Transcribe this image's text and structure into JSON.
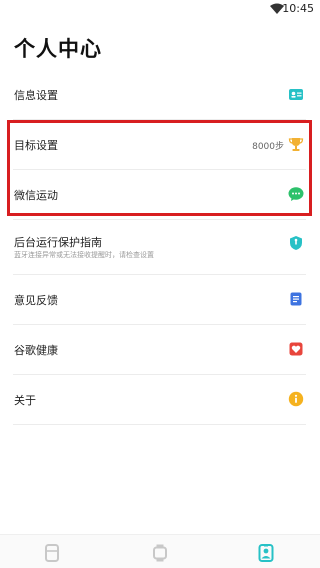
{
  "status_bar": {
    "time": "10:45"
  },
  "header": {
    "title": "个人中心"
  },
  "menu": [
    {
      "label": "信息设置",
      "icon": "id-card-icon"
    },
    {
      "label": "目标设置",
      "value": "8000步",
      "icon": "trophy-icon"
    },
    {
      "label": "微信运动",
      "icon": "wechat-icon"
    },
    {
      "label": "后台运行保护指南",
      "sub": "蓝牙连接异常或无法接收提醒时，请检查设置",
      "icon": "shield-icon"
    },
    {
      "label": "意见反馈",
      "icon": "feedback-icon"
    },
    {
      "label": "谷歌健康",
      "icon": "heart-icon"
    },
    {
      "label": "关于",
      "icon": "info-icon"
    }
  ],
  "tabs": [
    {
      "icon": "device-icon",
      "active": false
    },
    {
      "icon": "watch-icon",
      "active": false
    },
    {
      "icon": "profile-icon",
      "active": true
    }
  ],
  "colors": {
    "accent": "#27c1c6",
    "highlight": "#d81e20",
    "trophy": "#f2b133",
    "wechat": "#2dc16b",
    "feedback": "#3d73e0",
    "heart": "#e8453c",
    "info": "#f5b21f"
  }
}
